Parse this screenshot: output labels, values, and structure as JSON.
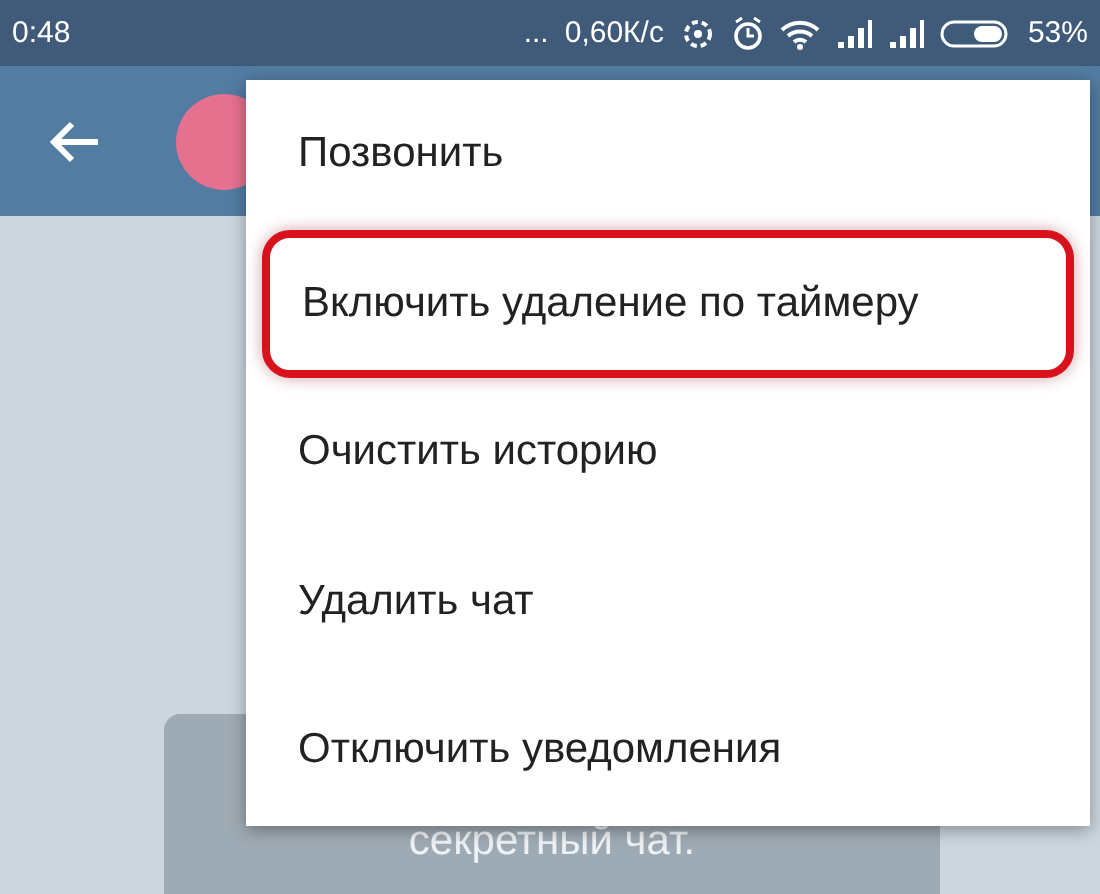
{
  "status_bar": {
    "time": "0:48",
    "more": "...",
    "speed": "0,60К/с",
    "battery": "53%"
  },
  "menu": {
    "items": [
      {
        "label": "Позвонить",
        "highlighted": false
      },
      {
        "label": "Включить удаление по таймеру",
        "highlighted": true
      },
      {
        "label": "Очистить историю",
        "highlighted": false
      },
      {
        "label": "Удалить чат",
        "highlighted": false
      },
      {
        "label": "Отключить уведомления",
        "highlighted": false
      }
    ]
  },
  "chat": {
    "message": "секретный чат."
  }
}
